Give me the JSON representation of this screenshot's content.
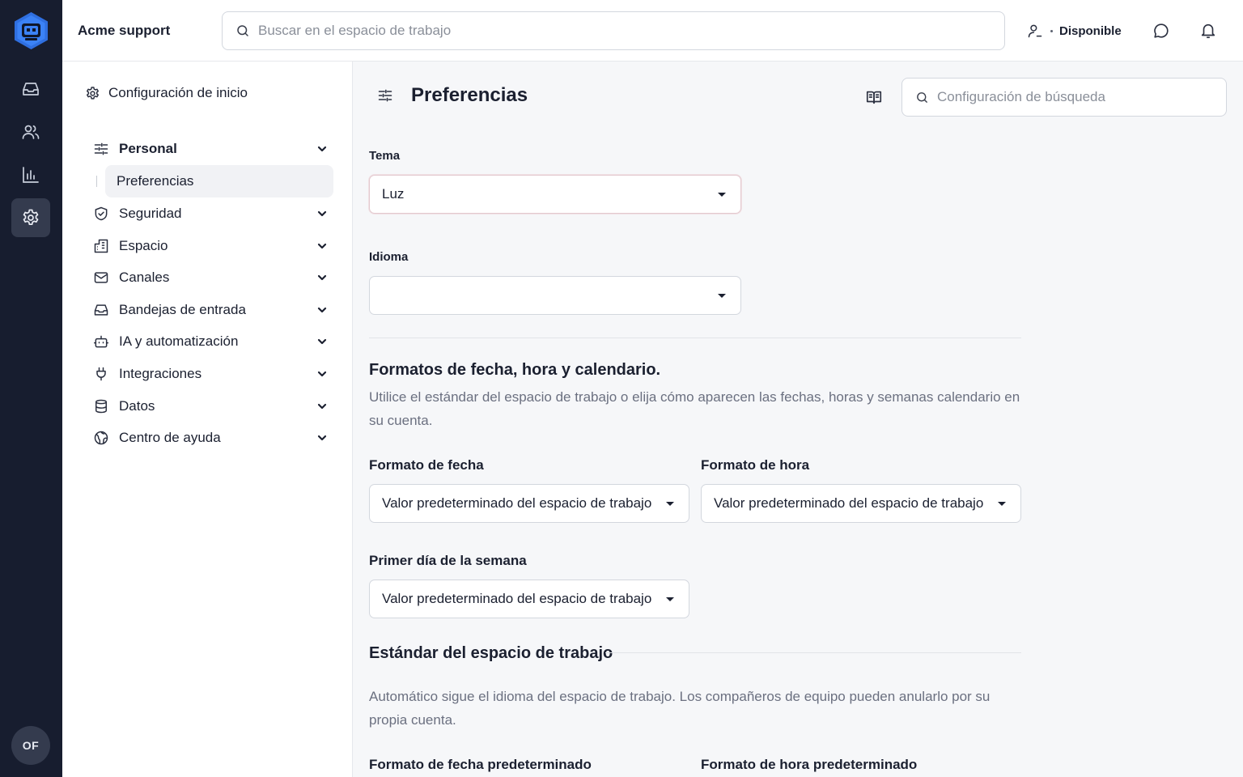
{
  "rail": {
    "logo": "robot-logo-icon",
    "nav": [
      "inbox-icon",
      "contacts-icon",
      "reports-icon",
      "settings-icon"
    ],
    "avatar_initials": "OF",
    "brand_color": "#2f6fe0"
  },
  "header": {
    "workspace_name": "Acme support",
    "search_placeholder": "Buscar en el espacio de trabajo",
    "status_label": "Disponible"
  },
  "sidebar": {
    "home_label": "Configuración de inicio",
    "groups": [
      {
        "label": "Personal",
        "icon": "sliders-icon",
        "expanded": true
      },
      {
        "label": "Seguridad",
        "icon": "shield-icon"
      },
      {
        "label": "Espacio",
        "icon": "building-icon"
      },
      {
        "label": "Canales",
        "icon": "mail-icon"
      },
      {
        "label": "Bandejas de entrada",
        "icon": "inbox-icon"
      },
      {
        "label": "IA y automatización",
        "icon": "robot-icon"
      },
      {
        "label": "Integraciones",
        "icon": "plug-icon"
      },
      {
        "label": "Datos",
        "icon": "database-icon"
      },
      {
        "label": "Centro de ayuda",
        "icon": "globe-icon"
      }
    ],
    "active_sub": "Preferencias"
  },
  "main": {
    "title": "Preferencias",
    "settings_search_placeholder": "Configuración de búsqueda",
    "theme": {
      "label": "Tema",
      "value": "Luz"
    },
    "language": {
      "label": "Idioma",
      "value": ""
    },
    "formats": {
      "title": "Formatos de fecha, hora y calendario.",
      "description": "Utilice el estándar del espacio de trabajo o elija cómo aparecen las fechas, horas y semanas calendario en su cuenta.",
      "date_format": {
        "label": "Formato de fecha",
        "value": "Valor predeterminado del espacio de trabajo"
      },
      "time_format": {
        "label": "Formato de hora",
        "value": "Valor predeterminado del espacio de trabajo"
      },
      "first_day": {
        "label": "Primer día de la semana",
        "value": "Valor predeterminado del espacio de trabajo"
      }
    },
    "workspace_standard": {
      "title": "Estándar del espacio de trabajo",
      "description": "Automático sigue el idioma del espacio de trabajo. Los compañeros de equipo pueden anularlo por su propia cuenta.",
      "default_date_label": "Formato de fecha predeterminado",
      "default_time_label": "Formato de hora predeterminado"
    }
  }
}
